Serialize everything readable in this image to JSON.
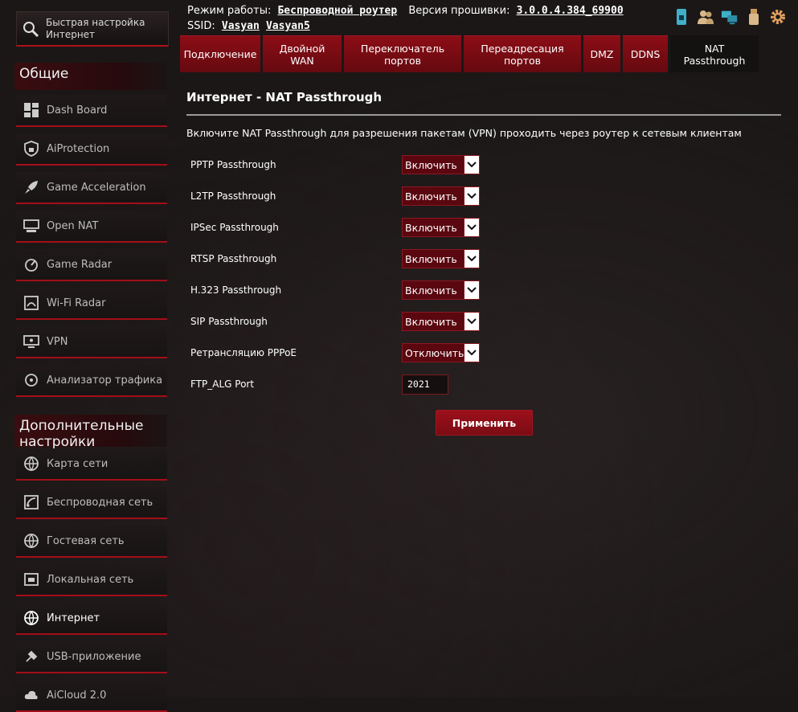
{
  "sidebar": {
    "quick_setup": "Быстрая настройка Интернет",
    "section_general": "Общие",
    "general_items": [
      {
        "label": "Dash Board",
        "icon": "dashboard-icon"
      },
      {
        "label": "AiProtection",
        "icon": "shield-lock-icon"
      },
      {
        "label": "Game Acceleration",
        "icon": "rocket-icon"
      },
      {
        "label": "Open NAT",
        "icon": "open-nat-icon"
      },
      {
        "label": "Game Radar",
        "icon": "radar-icon"
      },
      {
        "label": "Wi-Fi Radar",
        "icon": "wifi-radar-icon"
      },
      {
        "label": "VPN",
        "icon": "vpn-monitor-icon"
      },
      {
        "label": "Анализатор трафика",
        "icon": "traffic-analyzer-icon"
      }
    ],
    "section_advanced": "Дополнительные настройки",
    "advanced_items": [
      {
        "label": "Карта сети",
        "icon": "globe-icon"
      },
      {
        "label": "Беспроводная сеть",
        "icon": "wireless-icon"
      },
      {
        "label": "Гостевая сеть",
        "icon": "guest-globe-icon"
      },
      {
        "label": "Локальная сеть",
        "icon": "lan-icon"
      },
      {
        "label": "Интернет",
        "icon": "internet-globe-icon",
        "active": true
      },
      {
        "label": "USB-приложение",
        "icon": "usb-icon"
      },
      {
        "label": "AiCloud 2.0",
        "icon": "cloud-icon"
      }
    ]
  },
  "status": {
    "mode_label": "Режим работы:",
    "mode_value": "Беспроводной роутер",
    "firmware_label": "Версия прошивки:",
    "firmware_value": "3.0.0.4.384_69900",
    "ssid_label": "SSID:",
    "ssid_1": "Vasyan",
    "ssid_2": "Vasyan5"
  },
  "top_icons": [
    "sim-card-icon",
    "users-icon",
    "network-computers-icon",
    "usb-drive-icon",
    "gear-icon"
  ],
  "tabs": [
    {
      "label": "Подключение",
      "width": 100
    },
    {
      "label": "Двойной WAN",
      "width": 98
    },
    {
      "label": "Переключатель портов",
      "width": 146
    },
    {
      "label": "Переадресация портов",
      "width": 146
    },
    {
      "label": "DMZ",
      "width": 46
    },
    {
      "label": "DDNS",
      "width": 56
    },
    {
      "label": "NAT Passthrough",
      "width": 110,
      "active": true
    }
  ],
  "page": {
    "title": "Интернет - NAT Passthrough",
    "description": "Включите NAT Passthrough для разрешения пакетам (VPN) проходить через роутер к сетевым клиентам",
    "apply_label": "Применить"
  },
  "settings": [
    {
      "label": "PPTP Passthrough",
      "value": "Включить"
    },
    {
      "label": "L2TP Passthrough",
      "value": "Включить"
    },
    {
      "label": "IPSec Passthrough",
      "value": "Включить"
    },
    {
      "label": "RTSP Passthrough",
      "value": "Включить"
    },
    {
      "label": "H.323 Passthrough",
      "value": "Включить"
    },
    {
      "label": "SIP Passthrough",
      "value": "Включить"
    },
    {
      "label": "Ретрансляцию PPPoE",
      "value": "Отключить"
    }
  ],
  "ftp_alg": {
    "label": "FTP_ALG Port",
    "value": "2021"
  },
  "colors": {
    "accent": "#8c0d16",
    "rule": "#a30e18",
    "background": "#1b1717"
  }
}
